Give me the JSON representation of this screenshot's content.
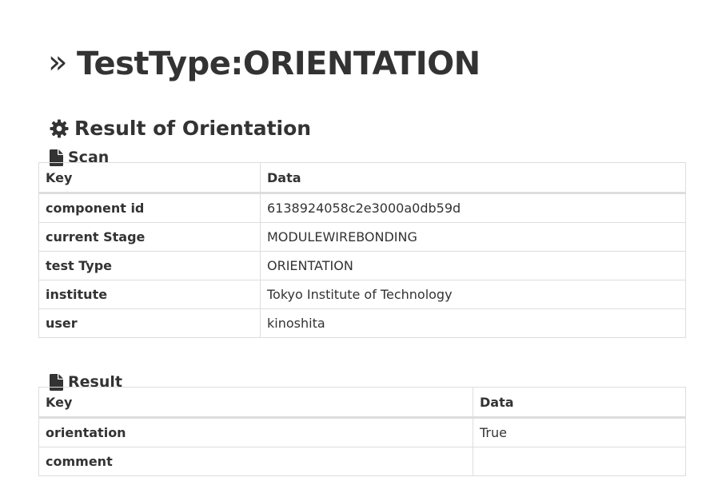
{
  "page_title": {
    "chevron": "»",
    "text": "TestType:ORIENTATION"
  },
  "section": {
    "icon": "gear-icon",
    "title": "Result of Orientation"
  },
  "scan": {
    "icon": "file-icon",
    "title": "Scan",
    "headers": {
      "key": "Key",
      "data": "Data"
    },
    "rows": [
      {
        "key": "component id",
        "value": "6138924058c2e3000a0db59d"
      },
      {
        "key": "current Stage",
        "value": "MODULEWIREBONDING"
      },
      {
        "key": "test Type",
        "value": "ORIENTATION"
      },
      {
        "key": "institute",
        "value": "Tokyo Institute of Technology"
      },
      {
        "key": "user",
        "value": "kinoshita"
      }
    ]
  },
  "result": {
    "icon": "file-icon",
    "title": "Result",
    "headers": {
      "key": "Key",
      "data": "Data"
    },
    "rows": [
      {
        "key": "orientation",
        "value": "True"
      },
      {
        "key": "comment",
        "value": ""
      }
    ]
  }
}
